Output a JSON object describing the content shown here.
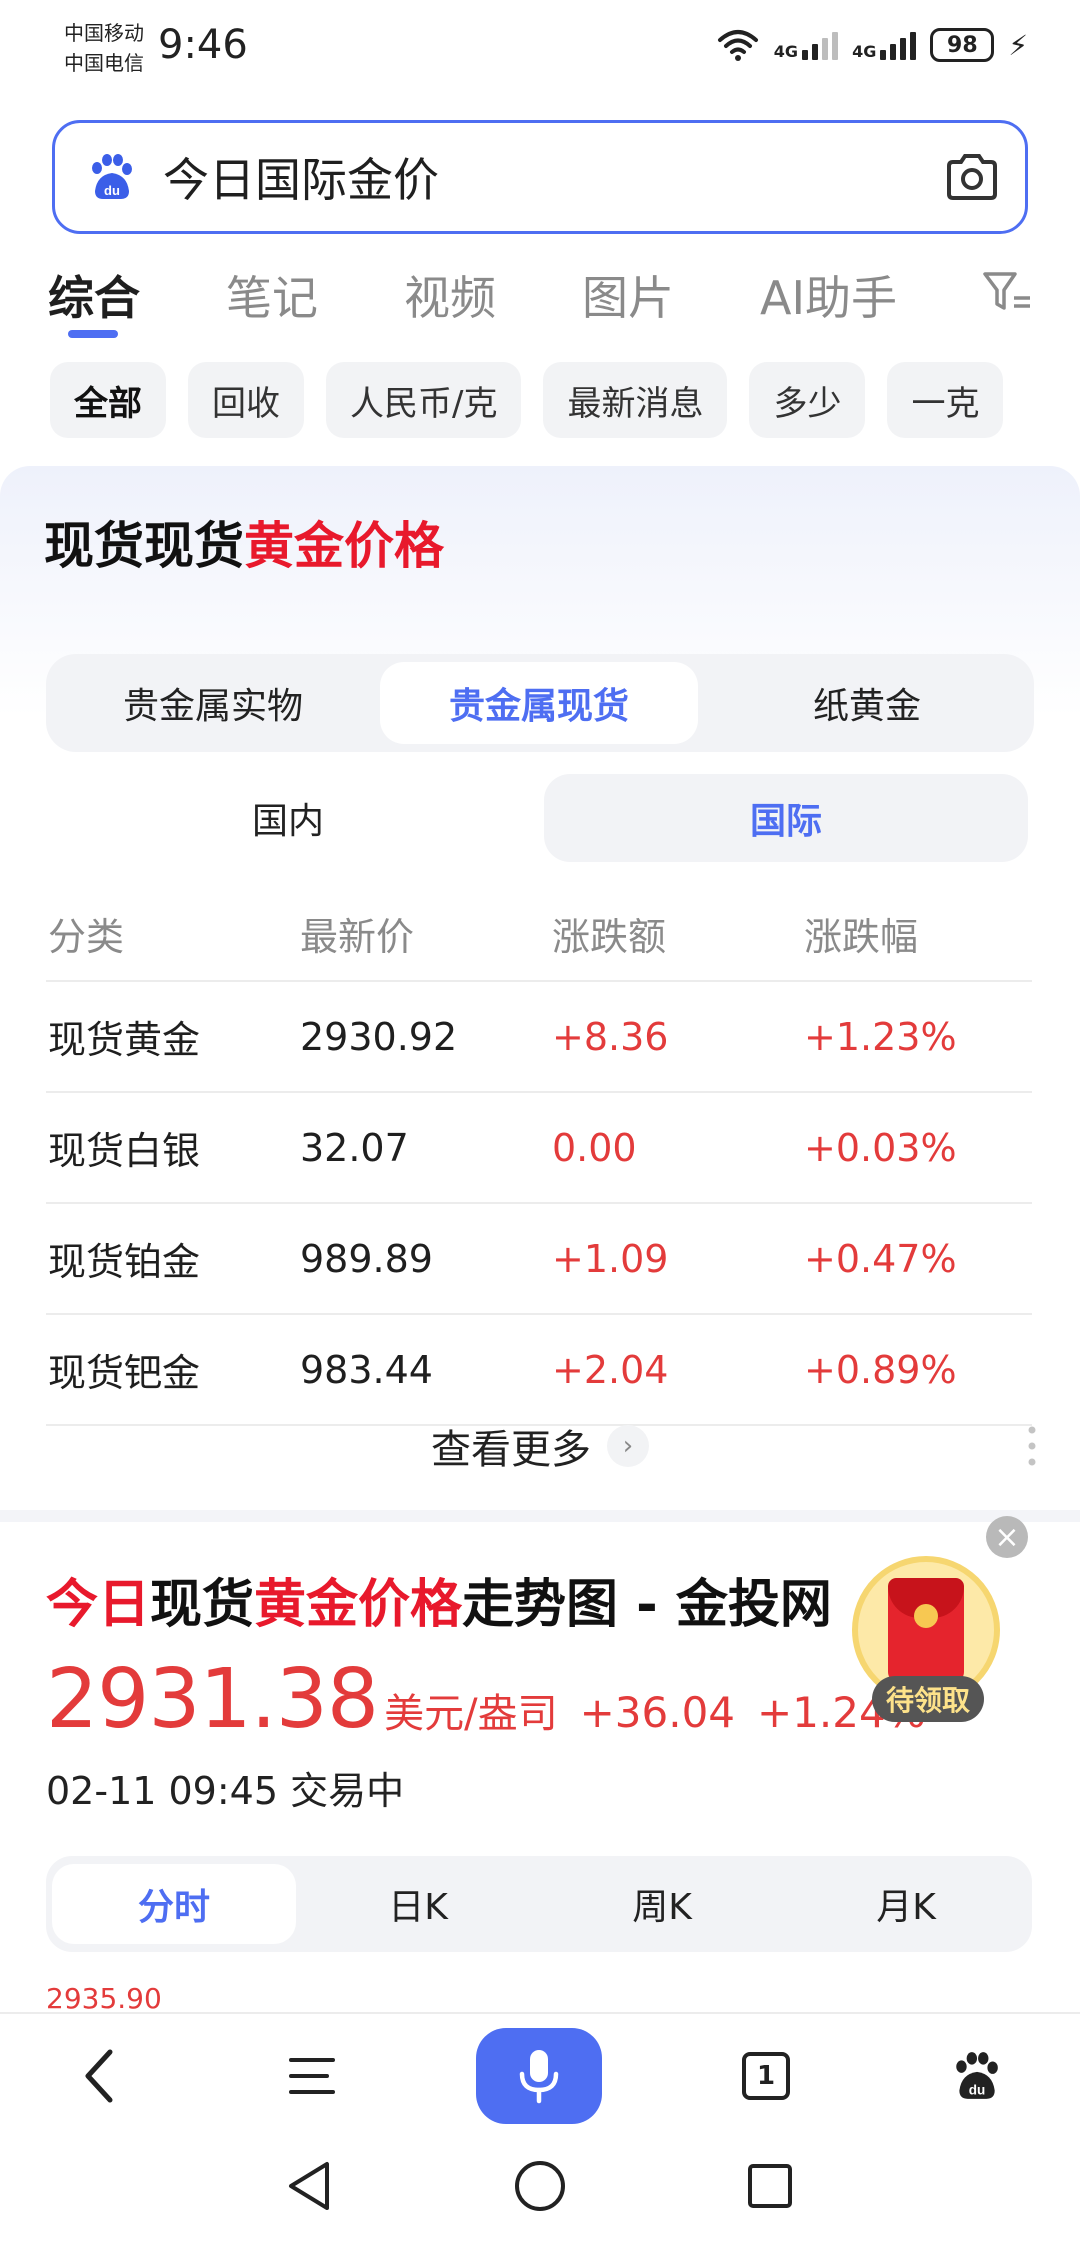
{
  "status_bar": {
    "carrier1": "中国移动",
    "carrier2": "中国电信",
    "time": "9:46",
    "network1": "4G",
    "network2": "4G",
    "battery": "98"
  },
  "search": {
    "query": "今日国际金价"
  },
  "tabs": [
    {
      "label": "综合",
      "active": true
    },
    {
      "label": "笔记"
    },
    {
      "label": "视频"
    },
    {
      "label": "图片"
    },
    {
      "label": "AI助手"
    }
  ],
  "chips": [
    "全部",
    "回收",
    "人民币/克",
    "最新消息",
    "多少",
    "一克"
  ],
  "card": {
    "title_part1": "现货现货",
    "title_part2": "黄金价格",
    "segments": [
      "贵金属实物",
      "贵金属现货",
      "纸黄金"
    ],
    "active_segment": "贵金属现货",
    "regions": [
      "国内",
      "国际"
    ],
    "active_region": "国际",
    "table": {
      "headers": [
        "分类",
        "最新价",
        "涨跌额",
        "涨跌幅"
      ],
      "rows": [
        [
          "现货黄金",
          "2930.92",
          "+8.36",
          "+1.23%"
        ],
        [
          "现货白银",
          "32.07",
          "0.00",
          "+0.03%"
        ],
        [
          "现货铂金",
          "989.89",
          "+1.09",
          "+0.47%"
        ],
        [
          "现货钯金",
          "983.44",
          "+2.04",
          "+0.89%"
        ]
      ]
    },
    "view_more": "查看更多"
  },
  "result": {
    "title_red1": "今日",
    "title_black1": "现货",
    "title_red2": "黄金价格",
    "title_black2": "走势图 - 金投网",
    "price": "2931.38",
    "unit": "美元/盎司",
    "change": "+36.04",
    "change_pct": "+1.24%",
    "date": "02-11 09:45 交易中",
    "chart_tabs": [
      "分时",
      "日K",
      "周K",
      "月K"
    ],
    "active_chart_tab": "分时",
    "chart_max": "2935.90"
  },
  "red_packet": {
    "label": "待领取"
  },
  "bottom_nav": {
    "tab_count": "1"
  },
  "colors": {
    "accent": "#4e6ef2",
    "rise": "#e33b3b",
    "highlight": "#e8192c"
  }
}
